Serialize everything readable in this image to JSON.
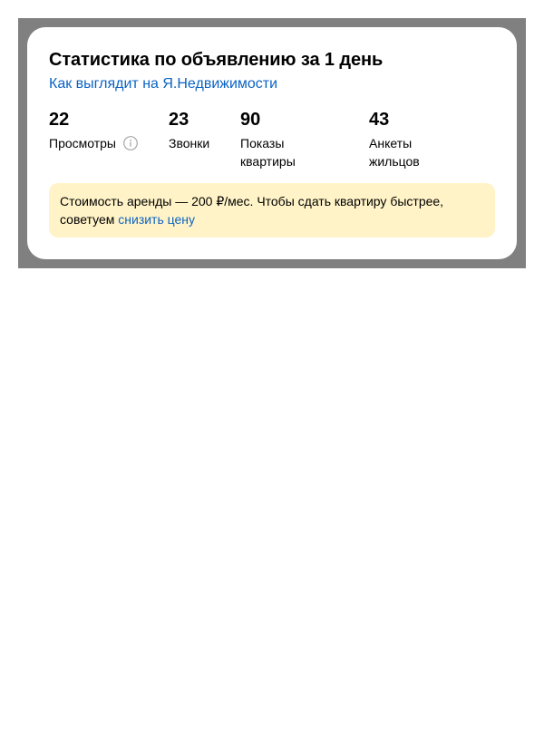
{
  "card": {
    "title": "Статистика по объявлению за 1 день",
    "preview_link": "Как выглядит на Я.Недвижимости"
  },
  "stats": [
    {
      "value": "22",
      "label": "Просмотры"
    },
    {
      "value": "23",
      "label": "Звонки"
    },
    {
      "value": "90",
      "label": "Показы квартиры"
    },
    {
      "value": "43",
      "label": "Анкеты жильцов"
    }
  ],
  "notice": {
    "text_line": "Стоимость аренды — 200 ₽/мес. Чтобы сдать квартиру быстрее, советуем",
    "link": "снизить цену"
  },
  "icons": {
    "views_info": "info-icon"
  },
  "colors": {
    "frame": "#808080",
    "card": "#ffffff",
    "link": "#0b63c4",
    "notice_bg": "#fff3c7",
    "icon_gray": "#a6a6a6"
  }
}
